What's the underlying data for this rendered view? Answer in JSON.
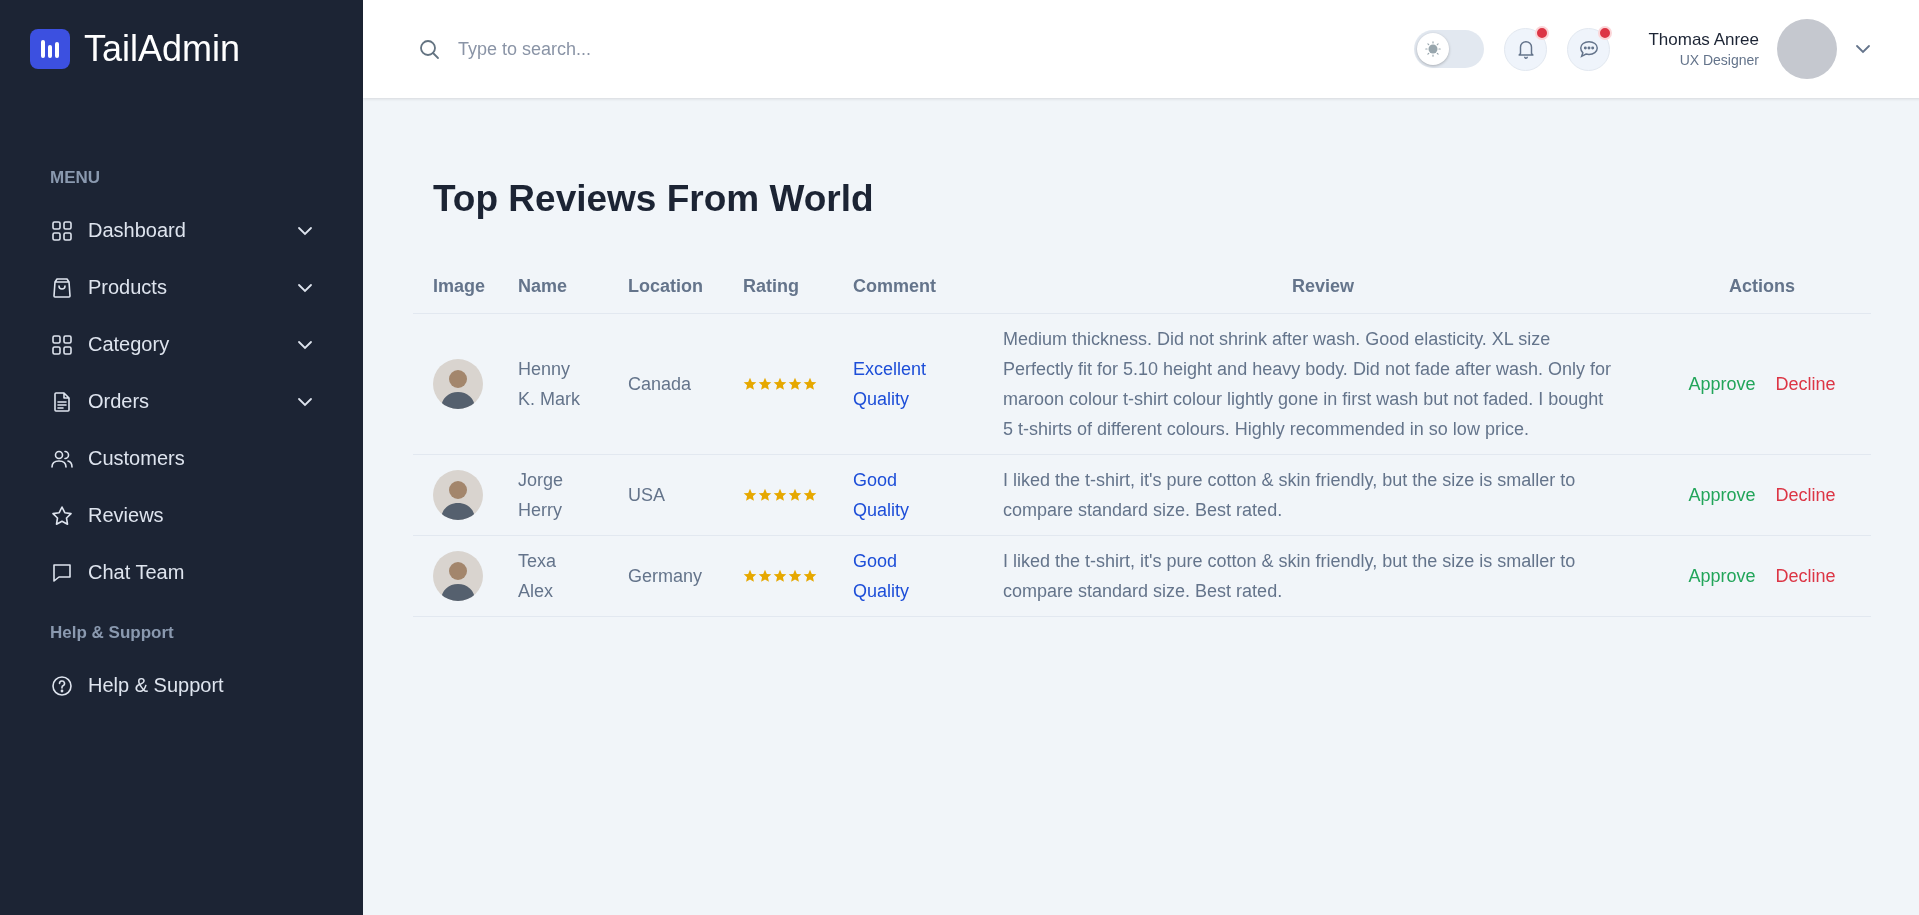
{
  "sidebar": {
    "logo": "TailAdmin",
    "sections": [
      {
        "title": "MENU",
        "items": [
          {
            "label": "Dashboard",
            "kind": "dropdown",
            "expanded": false
          },
          {
            "label": "Products",
            "kind": "dropdown",
            "expanded": false
          },
          {
            "label": "Category",
            "kind": "dropdown",
            "expanded": false
          },
          {
            "label": "Orders",
            "kind": "dropdown",
            "expanded": false
          },
          {
            "label": "Customers",
            "kind": "link"
          },
          {
            "label": "Reviews",
            "kind": "link"
          },
          {
            "label": "Chat Team",
            "kind": "link"
          }
        ]
      },
      {
        "title": "Help & Support",
        "items": [
          {
            "label": "Help & Support",
            "kind": "link"
          }
        ]
      }
    ]
  },
  "header": {
    "search": {
      "placeholder": "Type to search..."
    },
    "dark_mode": false,
    "notifications_unread": true,
    "messages_unread": true,
    "user": {
      "name": "Thomas Anree",
      "role": "UX Designer"
    }
  },
  "page": {
    "title": "Top Reviews From World",
    "table": {
      "columns": [
        "Image",
        "Name",
        "Location",
        "Rating",
        "Comment",
        "Review",
        "Actions"
      ],
      "rows": [
        {
          "name": "Henny K. Mark",
          "location": "Canada",
          "stars": 5,
          "comment": "Excellent Quality",
          "review": "Medium thickness. Did not shrink after wash. Good elasticity. XL size Perfectly fit for 5.10 height and heavy body. Did not fade after wash. Only for maroon colour t-shirt colour lightly gone in first wash but not faded. I bought 5 t-shirts of different colours. Highly recommended in so low price.",
          "actions": [
            {
              "label": "Approve",
              "kind": "approve"
            },
            {
              "label": "Decline",
              "kind": "decline"
            }
          ]
        },
        {
          "name": "Jorge Herry",
          "location": "USA",
          "stars": 5,
          "comment": "Good Quality",
          "review": "I liked the t-shirt, it's pure cotton & skin friendly, but the size is smaller to compare standard size. Best rated.",
          "actions": [
            {
              "label": "Approve",
              "kind": "approve"
            },
            {
              "label": "Decline",
              "kind": "decline"
            }
          ]
        },
        {
          "name": "Texa Alex",
          "location": "Germany",
          "stars": 5,
          "comment": "Good Quality",
          "review": "I liked the t-shirt, it's pure cotton & skin friendly, but the size is smaller to compare standard size. Best rated.",
          "actions": [
            {
              "label": "Approve",
              "kind": "approve"
            },
            {
              "label": "Decline",
              "kind": "decline"
            }
          ]
        }
      ]
    }
  }
}
